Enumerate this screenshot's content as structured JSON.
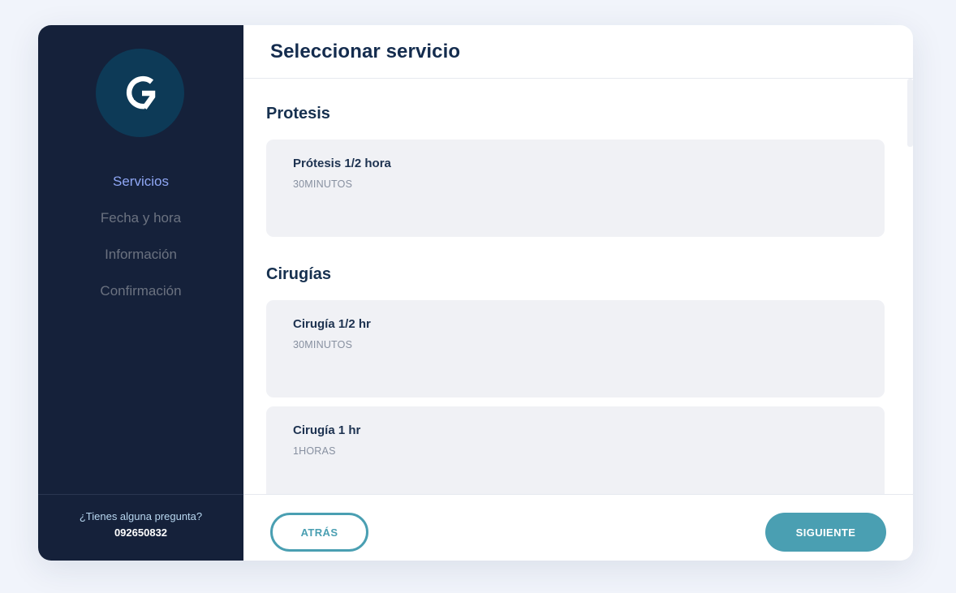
{
  "sidebar": {
    "logo_icon": "brand-logo-icon",
    "steps": [
      {
        "label": "Servicios",
        "active": true
      },
      {
        "label": "Fecha y hora",
        "active": false
      },
      {
        "label": "Información",
        "active": false
      },
      {
        "label": "Confirmación",
        "active": false
      }
    ],
    "help": {
      "question": "¿Tienes alguna pregunta?",
      "phone": "092650832"
    }
  },
  "header": {
    "title": "Seleccionar servicio"
  },
  "categories": [
    {
      "title": "Protesis",
      "services": [
        {
          "name": "Prótesis 1/2 hora",
          "duration": "30MINUTOS"
        }
      ]
    },
    {
      "title": "Cirugías",
      "services": [
        {
          "name": "Cirugía 1/2 hr",
          "duration": "30MINUTOS"
        },
        {
          "name": "Cirugía 1 hr",
          "duration": "1HORAS"
        }
      ]
    }
  ],
  "footer": {
    "back_label": "ATRÁS",
    "next_label": "SIGUIENTE"
  },
  "colors": {
    "sidebar_bg": "#15213a",
    "accent": "#4a9fb2",
    "active_step": "#8fa7f5"
  }
}
